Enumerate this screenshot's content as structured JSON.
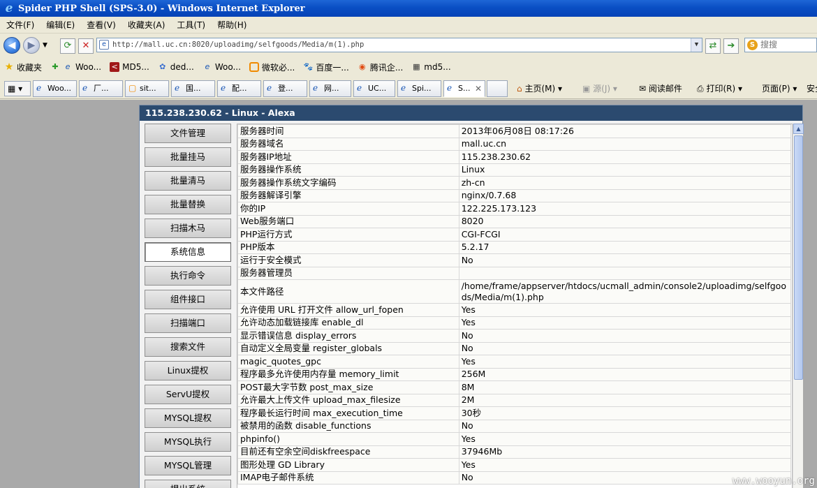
{
  "window": {
    "title": "Spider PHP Shell (SPS-3.0) - Windows Internet Explorer"
  },
  "menu": [
    "文件(F)",
    "编辑(E)",
    "查看(V)",
    "收藏夹(A)",
    "工具(T)",
    "帮助(H)"
  ],
  "address": {
    "url": "http://mall.uc.cn:8020/uploadimg/selfgoods/Media/m(1).php",
    "search_placeholder": "搜搜"
  },
  "favorites": {
    "label": "收藏夹",
    "items": [
      "Woo...",
      "MD5...",
      "ded...",
      "Woo...",
      "微软必...",
      "百度一...",
      "腾讯企...",
      "md5..."
    ]
  },
  "tabs": [
    "Woo...",
    "厂...",
    "sit...",
    "国...",
    "配...",
    "登...",
    "网...",
    "UC...",
    "Spi...",
    "S..."
  ],
  "command_bar": {
    "home": "主页(M)",
    "feeds": "源(J)",
    "read_mail": "阅读邮件",
    "print": "打印(R)",
    "page": "页面(P)",
    "safety": "安全"
  },
  "panel": {
    "header": "115.238.230.62 - Linux - Alexa"
  },
  "sidebar": [
    "文件管理",
    "批量挂马",
    "批量清马",
    "批量替换",
    "扫描木马",
    "系统信息",
    "执行命令",
    "组件接口",
    "扫描端口",
    "搜索文件",
    "Linux提权",
    "ServU提权",
    "MYSQL提权",
    "MYSQL执行",
    "MYSQL管理",
    "提出系统"
  ],
  "sidebar_active": "系统信息",
  "info_rows": [
    {
      "k": "服务器时间",
      "v": "2013年06月08日 08:17:26"
    },
    {
      "k": "服务器域名",
      "v": "mall.uc.cn"
    },
    {
      "k": "服务器IP地址",
      "v": "115.238.230.62"
    },
    {
      "k": "服务器操作系统",
      "v": "Linux"
    },
    {
      "k": "服务器操作系统文字编码",
      "v": "zh-cn"
    },
    {
      "k": "服务器解译引擎",
      "v": "nginx/0.7.68"
    },
    {
      "k": "你的IP",
      "v": "122.225.173.123"
    },
    {
      "k": "Web服务端口",
      "v": "8020"
    },
    {
      "k": "PHP运行方式",
      "v": "CGI-FCGI"
    },
    {
      "k": "PHP版本",
      "v": "5.2.17"
    },
    {
      "k": "运行于安全模式",
      "v": "No"
    },
    {
      "k": "服务器管理员",
      "v": ""
    },
    {
      "k": "本文件路径",
      "v": "/home/frame/appserver/htdocs/ucmall_admin/console2/uploadimg/selfgoods/Media/m(1).php"
    },
    {
      "k": "允许使用 URL 打开文件 allow_url_fopen",
      "v": "Yes"
    },
    {
      "k": "允许动态加载链接库 enable_dl",
      "v": "Yes"
    },
    {
      "k": "显示错误信息 display_errors",
      "v": "No"
    },
    {
      "k": "自动定义全局变量 register_globals",
      "v": "No"
    },
    {
      "k": "magic_quotes_gpc",
      "v": "Yes"
    },
    {
      "k": "程序最多允许使用内存量 memory_limit",
      "v": "256M"
    },
    {
      "k": "POST最大字节数 post_max_size",
      "v": "8M"
    },
    {
      "k": "允许最大上传文件 upload_max_filesize",
      "v": "2M"
    },
    {
      "k": "程序最长运行时间 max_execution_time",
      "v": "30秒"
    },
    {
      "k": "被禁用的函数 disable_functions",
      "v": "No"
    },
    {
      "k": "phpinfo()",
      "v": "Yes"
    },
    {
      "k": "目前还有空余空间diskfreespace",
      "v": "37946Mb"
    },
    {
      "k": "图形处理 GD Library",
      "v": "Yes"
    },
    {
      "k": "IMAP电子邮件系统",
      "v": "No"
    }
  ],
  "watermark": "www.wooyun.org"
}
